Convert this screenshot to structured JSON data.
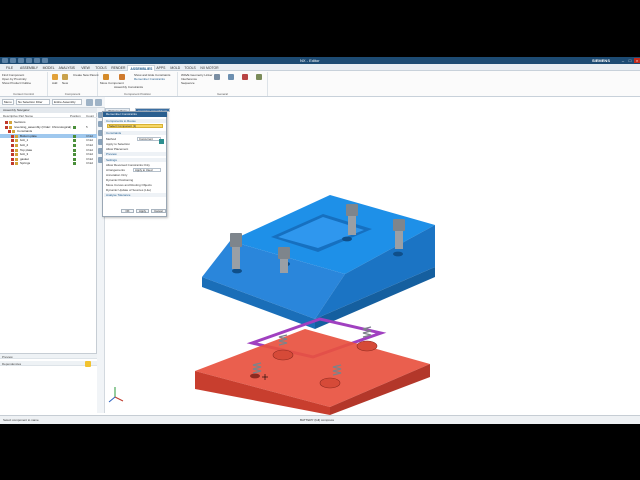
{
  "app": {
    "title": "NX - Editor",
    "brand": "SIEMENS"
  },
  "ribbon_tabs": [
    "FILE",
    "ASSEMBLY",
    "MODEL",
    "ANALYSIS",
    "VIEW",
    "TOOLS",
    "RENDER",
    "ASSEMBLIES",
    "APPS",
    "MOLD",
    "TOOLS",
    "NX MOTOR"
  ],
  "ribbon_active_tab_index": 7,
  "ribbon": {
    "groups": [
      "Context Control",
      "Component",
      "Component Position",
      "General"
    ],
    "items": [
      "Find Component",
      "Open by Proximity",
      "Show Product Outline",
      "Add",
      "New",
      "Create New Parent",
      "Move Component",
      "Assembly Constraints",
      "Show and Hide Constraints",
      "Remember Constraints",
      "Explode View",
      "Exploded Views",
      "WAVE Geometry Linker",
      "Sequence",
      "Interference",
      "Assembly Cut",
      "Mirror Assembly",
      "Pattern Component",
      "Replace Component"
    ]
  },
  "cmdbar": {
    "menu_label": "Menu",
    "filter_label": "No Selection Filter",
    "scope_label": "Entire Assembly"
  },
  "navigator": {
    "header": "Assembly Navigator",
    "columns": [
      "Descriptive Part Name",
      "Position",
      "Count"
    ],
    "rows": [
      {
        "label": "Sections",
        "indent": 1,
        "selected": false,
        "count": ""
      },
      {
        "label": "reversing_assembly (Order: Chronological)",
        "indent": 1,
        "selected": false,
        "count": "5"
      },
      {
        "label": "Constraints",
        "indent": 2,
        "selected": false,
        "count": ""
      },
      {
        "label": "Bottom plate",
        "indent": 3,
        "selected": true,
        "count": "Chkd"
      },
      {
        "label": "bolt_1",
        "indent": 3,
        "selected": false,
        "count": "Chkd"
      },
      {
        "label": "bolt_2",
        "indent": 3,
        "selected": false,
        "count": "Chkd"
      },
      {
        "label": "Top plate",
        "indent": 3,
        "selected": false,
        "count": "Chkd"
      },
      {
        "label": "bolt_3",
        "indent": 3,
        "selected": false,
        "count": "Chkd"
      },
      {
        "label": "gasket",
        "indent": 3,
        "selected": false,
        "count": "Chkd"
      },
      {
        "label": "Springs",
        "indent": 3,
        "selected": false,
        "count": "Chkd"
      }
    ]
  },
  "preview": {
    "section1": "Preview",
    "section2": "Dependencies"
  },
  "viewtabs": [
    "Welcome Page",
    "reversing_assembly.prt"
  ],
  "dialog": {
    "title": "Remember Constraints",
    "sec_components": "Components to Reuse",
    "select_component": "Select Component (1)",
    "sec_constraints": "Constraints",
    "method_label": "Method",
    "method_value": "Concurrent",
    "option1": "Apply to Selection",
    "option2": "Allow Placement",
    "sec_preview": "Preview",
    "sec_settings": "Settings",
    "setting1": "Allow Reversed Constraints Only",
    "arrangements_label": "Arrangements",
    "arrangements_value": "Apply to Used",
    "dynamic_label": "Annotation Only",
    "setting2": "Dynamic Positioning",
    "setting3": "Move Curves and Routing Objects",
    "setting4": "Dynamic Update of Sources (Lite)",
    "sec_tolerance": "Analyse Tolerance",
    "ok": "OK",
    "apply": "Apply",
    "cancel": "Cancel"
  },
  "status": {
    "left": "Select component to name",
    "center": "BATTERY (full) compress"
  },
  "colors": {
    "top_plate": "#1e90e8",
    "bottom_plate": "#e8513f",
    "gasket": "#a040c0",
    "bolt": "#8a8f95"
  }
}
